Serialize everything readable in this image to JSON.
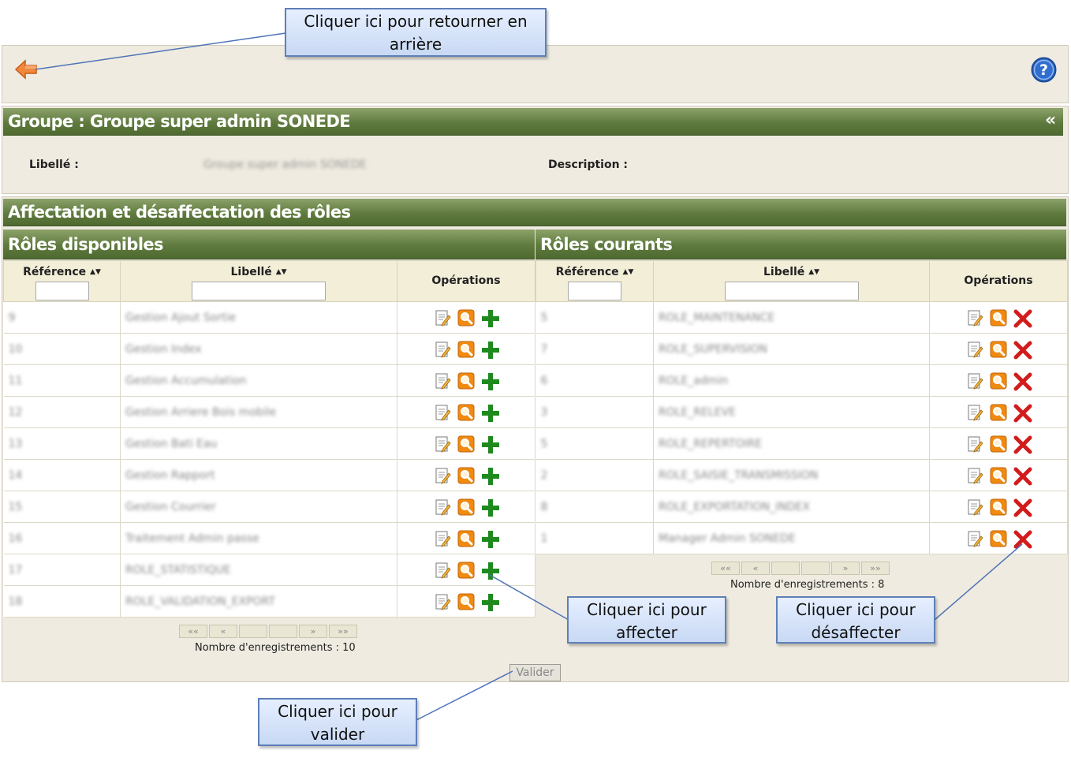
{
  "callouts": {
    "back": "Cliquer ici pour retourner en arrière",
    "assign": "Cliquer ici pour affecter",
    "unassign": "Cliquer ici pour désaffecter",
    "validate": "Cliquer ici pour valider"
  },
  "icons": {
    "back": "arrow-left-icon",
    "help": "help-icon",
    "edit": "edit-icon",
    "view": "magnifier-icon",
    "add": "plus-icon",
    "remove": "x-icon"
  },
  "colors": {
    "header_green": "#5f7a3e",
    "panel_bg": "#efebe0",
    "add_green": "#1e8a1e",
    "remove_red": "#d21c1c",
    "view_orange": "#f08a10",
    "help_blue": "#2e6fd0"
  },
  "group": {
    "title": "Groupe : Groupe super admin SONEDE",
    "collapse": "«",
    "libelle_label": "Libellé :",
    "libelle_value": "Groupe super admin SONEDE",
    "description_label": "Description :"
  },
  "roles": {
    "title": "Affectation et désaffectation des rôles",
    "available": {
      "title": "Rôles disponibles",
      "col_reference": "Référence",
      "col_libelle": "Libellé",
      "col_operations": "Opérations",
      "count_label": "Nombre d'enregistrements : 10",
      "rows": [
        {
          "ref": "9",
          "lib": "Gestion Ajout Sortie"
        },
        {
          "ref": "10",
          "lib": "Gestion Index"
        },
        {
          "ref": "11",
          "lib": "Gestion Accumulation"
        },
        {
          "ref": "12",
          "lib": "Gestion Arriere Bois mobile"
        },
        {
          "ref": "13",
          "lib": "Gestion Bati Eau"
        },
        {
          "ref": "14",
          "lib": "Gestion Rapport"
        },
        {
          "ref": "15",
          "lib": "Gestion Courrier"
        },
        {
          "ref": "16",
          "lib": "Traitement Admin passe"
        },
        {
          "ref": "17",
          "lib": "ROLE_STATISTIQUE"
        },
        {
          "ref": "18",
          "lib": "ROLE_VALIDATION_EXPORT"
        }
      ]
    },
    "current": {
      "title": "Rôles courants",
      "col_reference": "Référence",
      "col_libelle": "Libellé",
      "col_operations": "Opérations",
      "count_label": "Nombre d'enregistrements : 8",
      "rows": [
        {
          "ref": "5",
          "lib": "ROLE_MAINTENANCE"
        },
        {
          "ref": "7",
          "lib": "ROLE_SUPERVISION"
        },
        {
          "ref": "6",
          "lib": "ROLE_admin"
        },
        {
          "ref": "3",
          "lib": "ROLE_RELEVE"
        },
        {
          "ref": "5",
          "lib": "ROLE_REPERTOIRE"
        },
        {
          "ref": "2",
          "lib": "ROLE_SAISIE_TRANSMISSION"
        },
        {
          "ref": "8",
          "lib": "ROLE_EXPORTATION_INDEX"
        },
        {
          "ref": "1",
          "lib": "Manager Admin SONEDE"
        }
      ]
    },
    "pager": {
      "first": "««",
      "prev": "«",
      "next": "»",
      "last": "»»"
    }
  },
  "buttons": {
    "validate": "Valider"
  }
}
